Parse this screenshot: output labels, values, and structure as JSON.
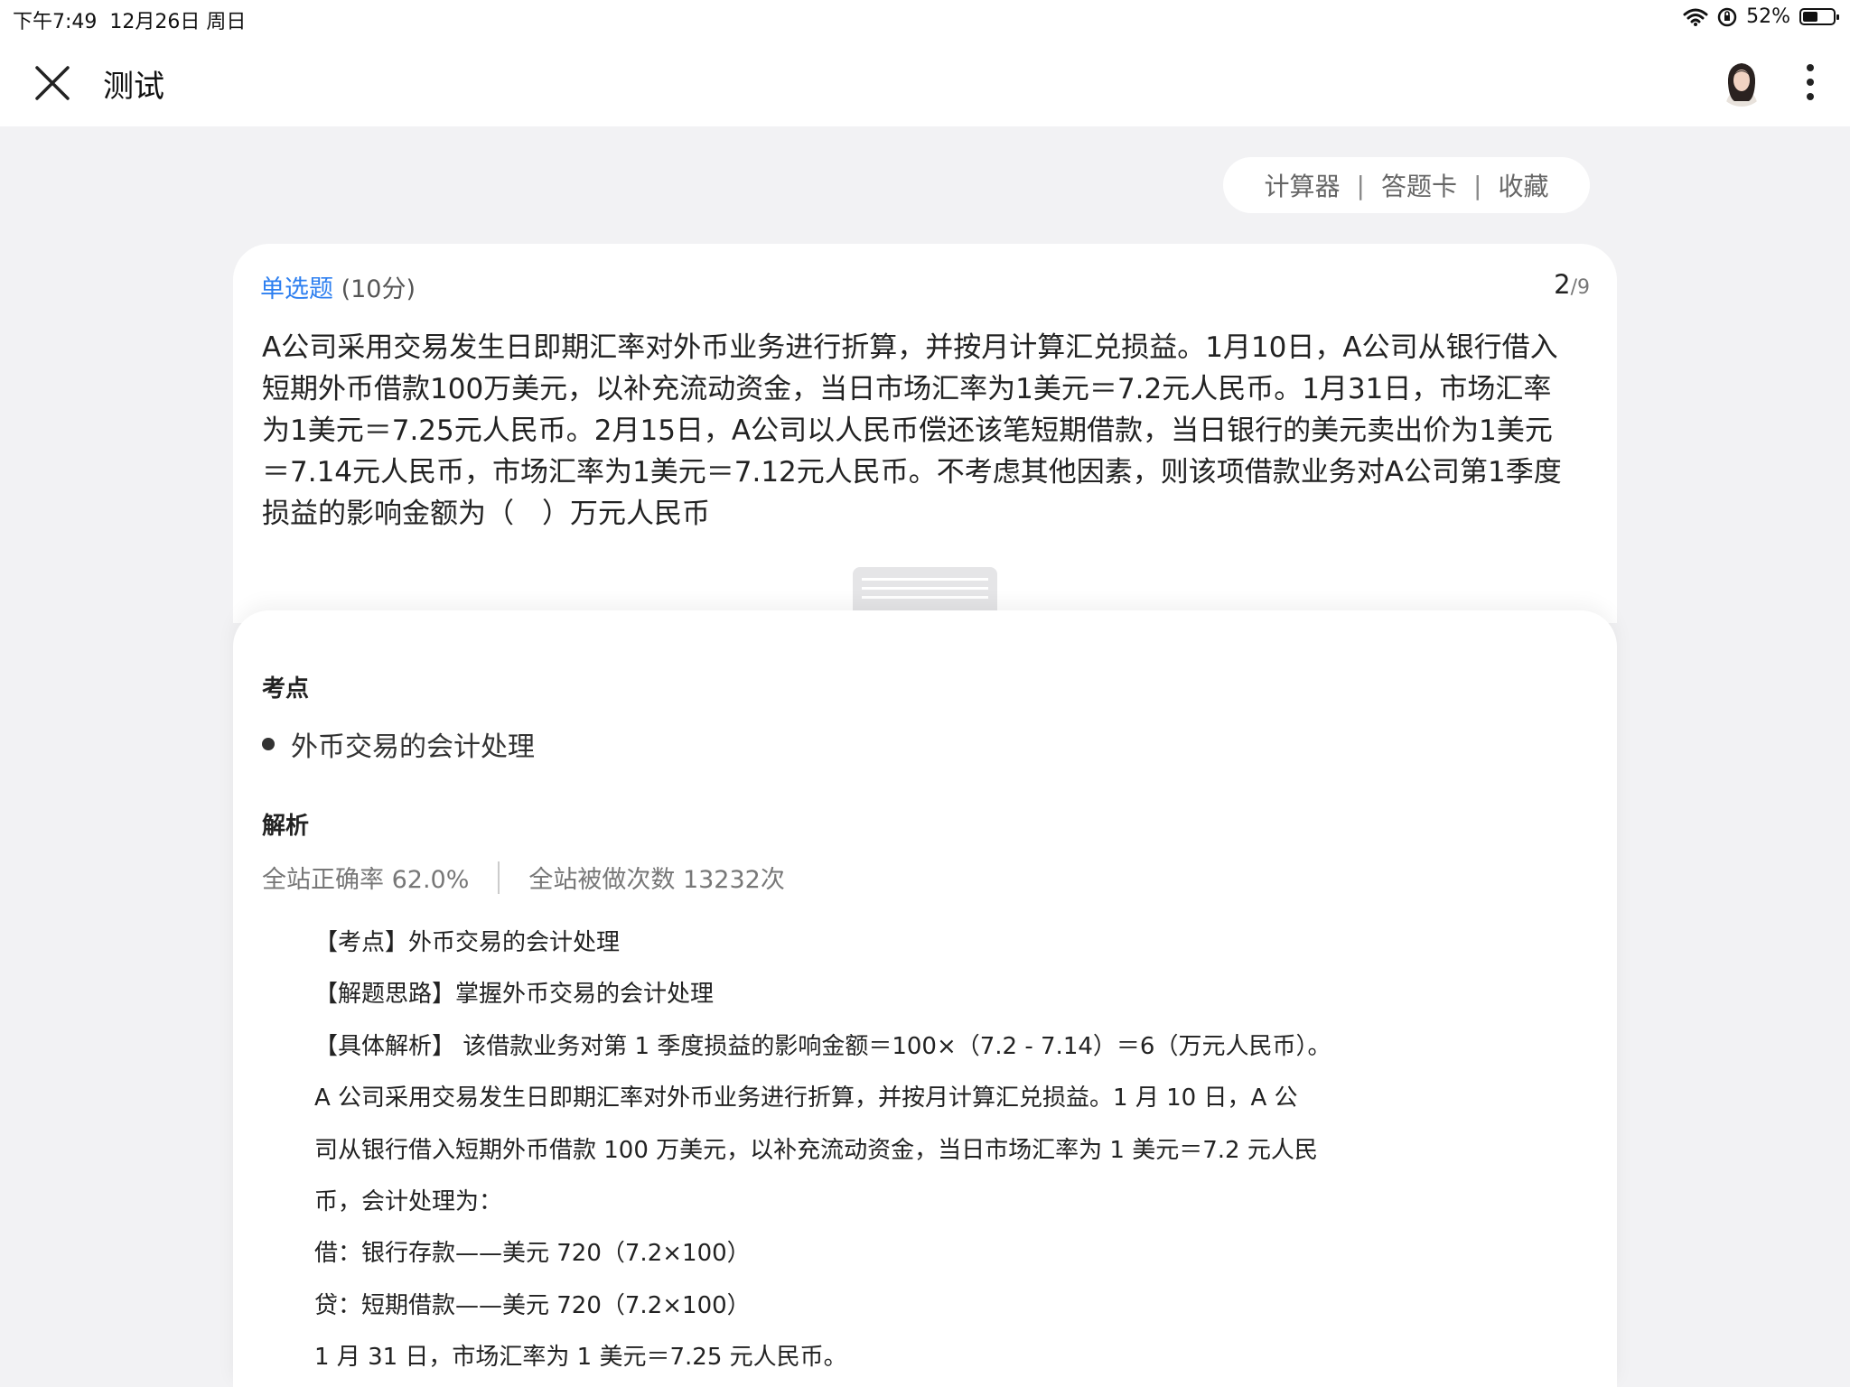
{
  "status_bar": {
    "time": "下午7:49",
    "date": "12月26日 周日",
    "battery": "52%",
    "battery_level": 0.52
  },
  "nav": {
    "close_icon": "close-icon",
    "title": "测试",
    "avatar": "user-avatar",
    "more_icon": "more-vertical-icon"
  },
  "tools": {
    "calculator": "计算器",
    "answer_card": "答题卡",
    "favorite": "收藏",
    "separator": "|"
  },
  "question": {
    "type": "单选题",
    "score": "(10分)",
    "current": "2",
    "total": "/9",
    "stem": "A公司采用交易发生日即期汇率对外币业务进行折算，并按月计算汇兑损益。1月10日，A公司从银行借入短期外币借款100万美元，以补充流动资金，当日市场汇率为1美元＝7.2元人民币。1月31日，市场汇率为1美元＝7.25元人民币。2月15日，A公司以人民币偿还该笔短期借款，当日银行的美元卖出价为1美元＝7.14元人民币，市场汇率为1美元＝7.12元人民币。不考虑其他因素，则该项借款业务对A公司第1季度损益的影响金额为（　）万元人民币"
  },
  "analysis": {
    "point_title": "考点",
    "point_item": "外币交易的会计处理",
    "analysis_title": "解析",
    "accuracy": "全站正确率 62.0%",
    "attempts": "全站被做次数 13232次",
    "lines": [
      "【考点】外币交易的会计处理",
      "【解题思路】掌握外币交易的会计处理",
      "【具体解析】 该借款业务对第 1 季度损益的影响金额＝100×（7.2 - 7.14）＝6（万元人民币）。",
      "A 公司采用交易发生日即期汇率对外币业务进行折算，并按月计算汇兑损益。1 月 10 日，A 公",
      "司从银行借入短期外币借款 100 万美元，以补充流动资金，当日市场汇率为 1 美元＝7.2 元人民",
      "币，会计处理为：",
      "借：银行存款——美元  720（7.2×100）",
      "贷：短期借款——美元  720（7.2×100）",
      "1 月 31 日，市场汇率为 1 美元＝7.25 元人民币。"
    ]
  }
}
